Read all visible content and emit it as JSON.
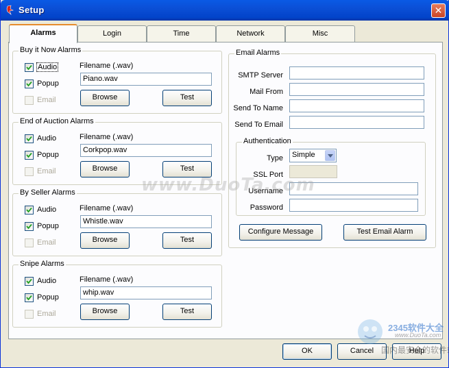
{
  "window": {
    "title": "Setup",
    "close_label": "✕"
  },
  "tabs": [
    "Alarms",
    "Login",
    "Time",
    "Network",
    "Misc"
  ],
  "alarm_groups": [
    {
      "title": "Buy it Now Alarms",
      "audio_label": "Audio",
      "popup_label": "Popup",
      "email_label": "Email",
      "filename_label": "Filename (.wav)",
      "filename": "Piano.wav",
      "browse_label": "Browse",
      "test_label": "Test",
      "audio_checked": true,
      "popup_checked": true,
      "email_checked": false
    },
    {
      "title": "End of Auction Alarms",
      "audio_label": "Audio",
      "popup_label": "Popup",
      "email_label": "Email",
      "filename_label": "Filename (.wav)",
      "filename": "Corkpop.wav",
      "browse_label": "Browse",
      "test_label": "Test",
      "audio_checked": true,
      "popup_checked": true,
      "email_checked": false
    },
    {
      "title": "By Seller Alarms",
      "audio_label": "Audio",
      "popup_label": "Popup",
      "email_label": "Email",
      "filename_label": "Filename (.wav)",
      "filename": "Whistle.wav",
      "browse_label": "Browse",
      "test_label": "Test",
      "audio_checked": true,
      "popup_checked": true,
      "email_checked": false
    },
    {
      "title": "Snipe Alarms",
      "audio_label": "Audio",
      "popup_label": "Popup",
      "email_label": "Email",
      "filename_label": "Filename (.wav)",
      "filename": "whip.wav",
      "browse_label": "Browse",
      "test_label": "Test",
      "audio_checked": true,
      "popup_checked": true,
      "email_checked": false
    }
  ],
  "email_alarms": {
    "title": "Email Alarms",
    "smtp_server_label": "SMTP Server",
    "smtp_server": "",
    "mail_from_label": "Mail From",
    "mail_from": "",
    "send_to_name_label": "Send To Name",
    "send_to_name": "",
    "send_to_email_label": "Send To Email",
    "send_to_email": "",
    "auth": {
      "title": "Authentication",
      "type_label": "Type",
      "type_value": "Simple",
      "ssl_port_label": "SSL Port",
      "ssl_port": "",
      "username_label": "Username",
      "username": "",
      "password_label": "Password",
      "password": ""
    },
    "configure_message_label": "Configure Message",
    "test_email_alarm_label": "Test Email Alarm"
  },
  "footer": {
    "ok_label": "OK",
    "cancel_label": "Cancel",
    "help_label": "Help"
  },
  "watermarks": {
    "site": "www.DuoTa.com",
    "brand": "2345软件大全",
    "brand_site": "www.DuoTa.com",
    "slogan": "国内最安全的软件站"
  }
}
